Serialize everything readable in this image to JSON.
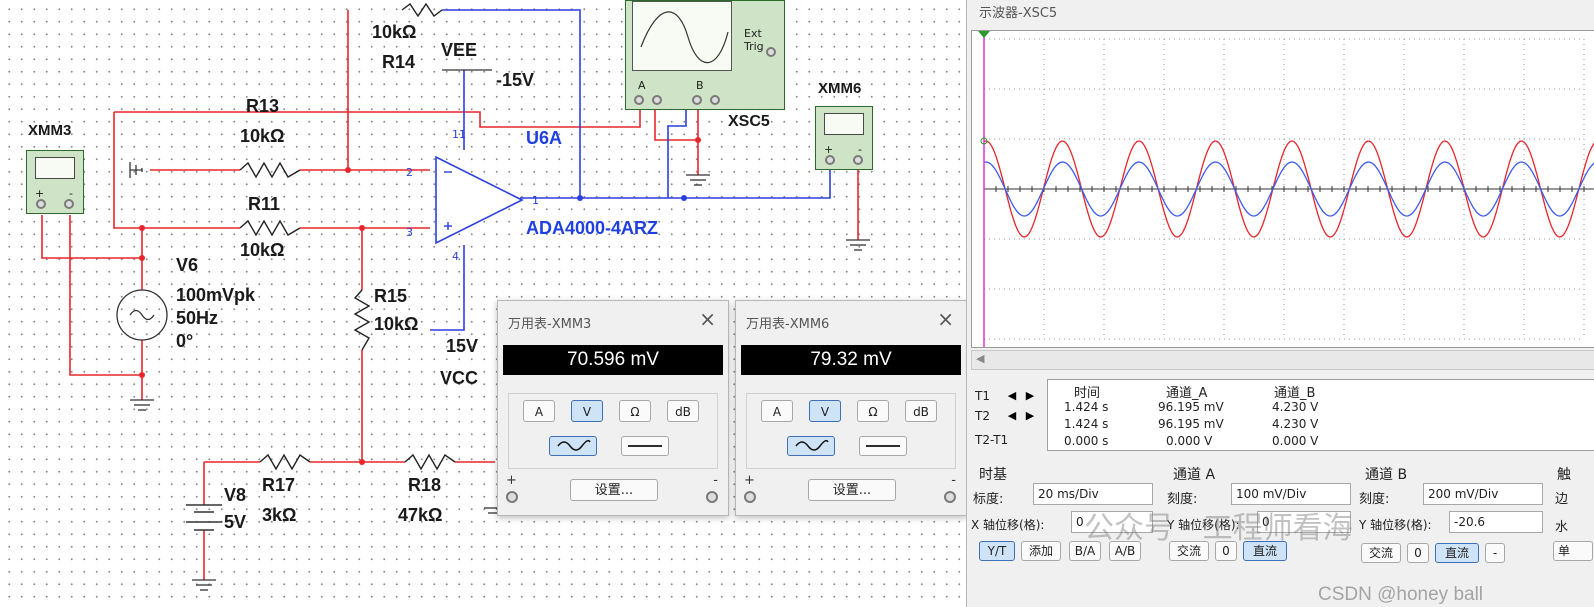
{
  "schematic": {
    "labels": {
      "r_top_value": "10kΩ",
      "r14_name": "R14",
      "vee_name": "VEE",
      "vee_value": "-15V",
      "r13_name": "R13",
      "r13_value": "10kΩ",
      "u6a_name": "U6A",
      "xmm3_name": "XMM3",
      "xmm6_name": "XMM6",
      "xsc5_name": "XSC5",
      "r11_name": "R11",
      "r11_value": "10kΩ",
      "opamp_part": "ADA4000-4ARZ",
      "v6_name": "V6",
      "v6_amp": "100mVpk",
      "v6_freq": "50Hz",
      "v6_phase": "0°",
      "r15_name": "R15",
      "r15_value": "10kΩ",
      "vcc_value": "15V",
      "vcc_name": "VCC",
      "v8_name": "V8",
      "v8_value": "5V",
      "r17_name": "R17",
      "r17_value": "3kΩ",
      "r18_name": "R18",
      "r18_value": "47kΩ",
      "ext_trig": "Ext Trig",
      "ch_a": "A",
      "ch_b": "B"
    },
    "pins": {
      "p11": "11",
      "p2": "2",
      "p3": "3",
      "p4": "4",
      "p1": "1"
    }
  },
  "multimeters": [
    {
      "title": "万用表-XMM3",
      "reading": "70.596 mV",
      "modes": [
        "A",
        "V",
        "Ω",
        "dB"
      ],
      "active_mode": "V",
      "setup_label": "设置...",
      "plus": "+",
      "minus": "-"
    },
    {
      "title": "万用表-XMM6",
      "reading": "79.32 mV",
      "modes": [
        "A",
        "V",
        "Ω",
        "dB"
      ],
      "active_mode": "V",
      "setup_label": "设置...",
      "plus": "+",
      "minus": "-"
    }
  ],
  "oscilloscope": {
    "title": "示波器-XSC5",
    "colors": {
      "channel_a": "#e8262b",
      "channel_b": "#3b5bf0",
      "cursor": "#e032e0"
    },
    "measurements": {
      "headers": [
        "时间",
        "通道_A",
        "通道_B"
      ],
      "rows": [
        {
          "label": "T1",
          "time": "1.424 s",
          "a": "96.195 mV",
          "b": "4.230 V"
        },
        {
          "label": "T2",
          "time": "1.424 s",
          "a": "96.195 mV",
          "b": "4.230 V"
        },
        {
          "label": "T2-T1",
          "time": "0.000 s",
          "a": "0.000 V",
          "b": "0.000 V"
        }
      ]
    },
    "timebase": {
      "title": "时基",
      "scale_label": "标度:",
      "scale_value": "20 ms/Div",
      "xpos_label": "X 轴位移(格):",
      "xpos_value": "0",
      "buttons": [
        "Y/T",
        "添加",
        "B/A",
        "A/B"
      ],
      "active": "Y/T"
    },
    "channel_a": {
      "title": "通道 A",
      "scale_label": "刻度:",
      "scale_value": "100 mV/Div",
      "ypos_label": "Y 轴位移(格):",
      "ypos_value": "0",
      "coupling": [
        "交流",
        "0",
        "直流"
      ],
      "active": "直流"
    },
    "channel_b": {
      "title": "通道 B",
      "scale_label": "刻度:",
      "scale_value": "200 mV/Div",
      "ypos_label": "Y 轴位移(格):",
      "ypos_value": "-20.6",
      "coupling": [
        "交流",
        "0",
        "直流",
        "-"
      ],
      "active": "直流"
    },
    "trigger_partial": {
      "title": "触",
      "edge": "边",
      "level": "水",
      "single": "单"
    }
  },
  "watermark": "公众号 · 工程师看海",
  "credit": "CSDN @honey ball"
}
